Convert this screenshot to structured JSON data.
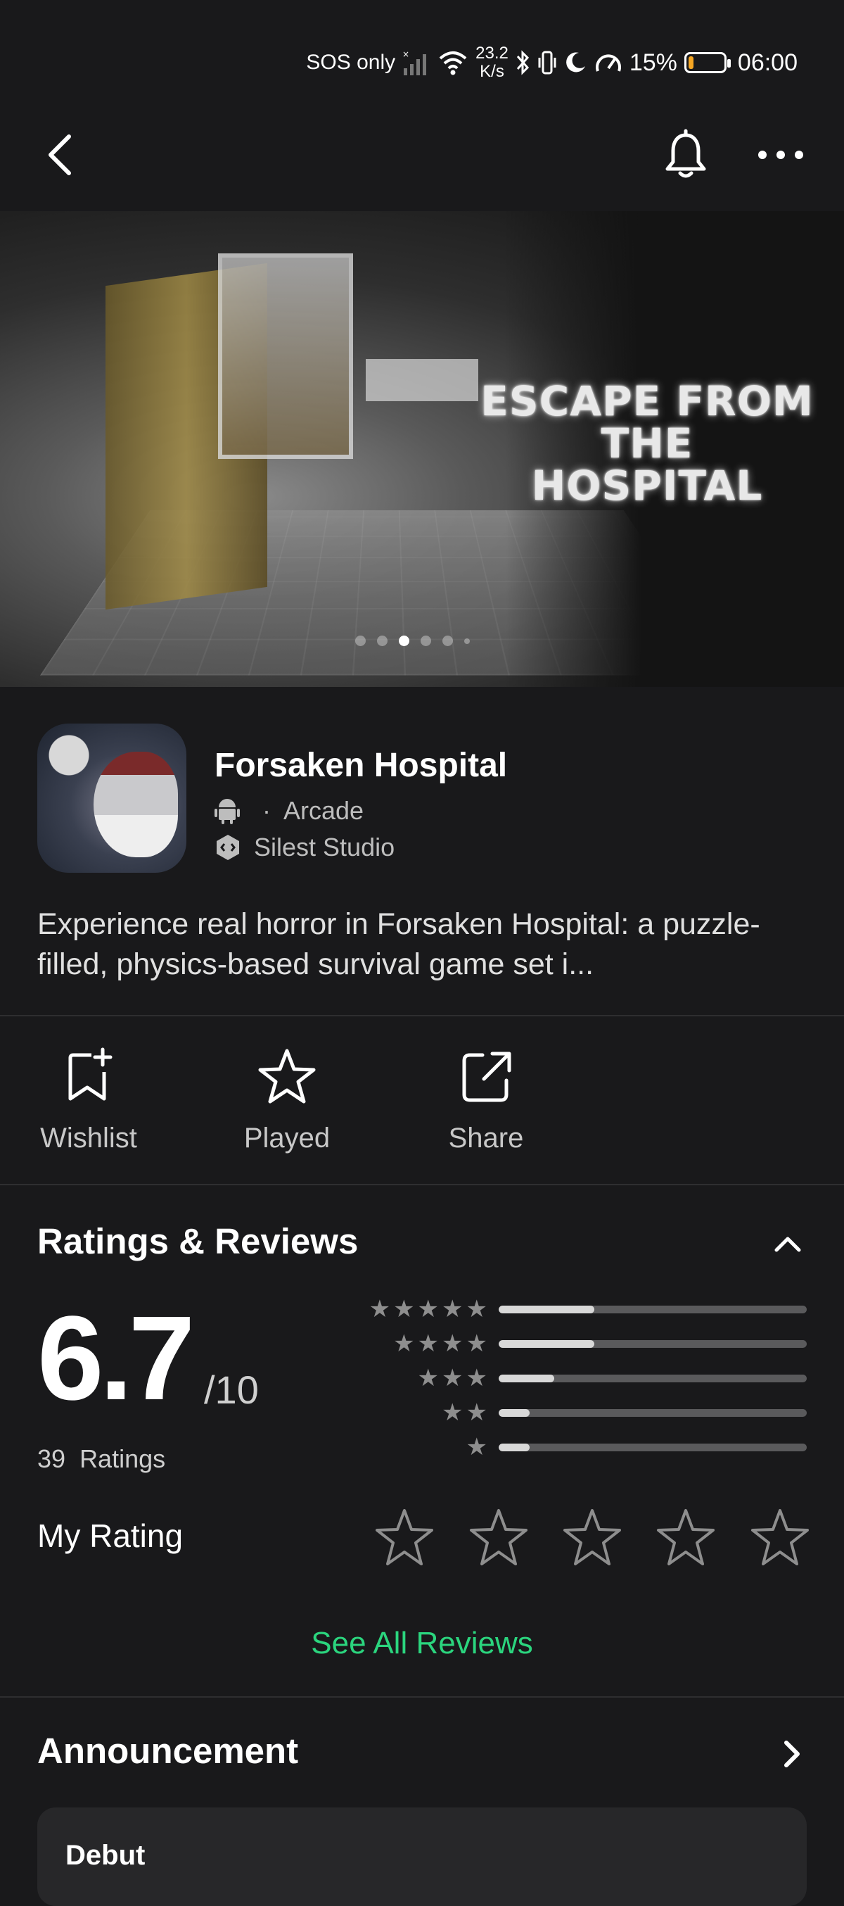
{
  "status_bar": {
    "carrier": "SOS only",
    "net_speed_value": "23.2",
    "net_speed_unit": "K/s",
    "battery_percent": "15%",
    "battery_level": 0.15,
    "time": "06:00",
    "battery_color": "#f5a623"
  },
  "nav": {
    "back_icon": "chevron-left-icon",
    "bell_icon": "bell-icon",
    "more_icon": "more-horizontal-icon"
  },
  "hero": {
    "title_lines": [
      "ESCAPE FROM",
      "THE",
      "HOSPITAL"
    ],
    "active_slide": 3,
    "slide_count": 6
  },
  "app": {
    "title": "Forsaken Hospital",
    "separator": "·",
    "genre": "Arcade",
    "developer": "Silest Studio",
    "platform_icon": "android-icon",
    "developer_icon": "studio-badge-icon",
    "description": "Experience real horror in Forsaken Hospital: a puzzle-filled, physics-based survival game set i..."
  },
  "actions": [
    {
      "label": "Wishlist",
      "icon": "bookmark-plus-icon"
    },
    {
      "label": "Played",
      "icon": "star-outline-icon"
    },
    {
      "label": "Share",
      "icon": "share-icon"
    }
  ],
  "ratings": {
    "section_title": "Ratings & Reviews",
    "score": "6.7",
    "score_scale": "/10",
    "count": "39",
    "count_label": "Ratings",
    "distribution": [
      {
        "stars": 5,
        "fraction": 0.31
      },
      {
        "stars": 4,
        "fraction": 0.31
      },
      {
        "stars": 3,
        "fraction": 0.18
      },
      {
        "stars": 2,
        "fraction": 0.1
      },
      {
        "stars": 1,
        "fraction": 0.1
      }
    ],
    "my_rating_label": "My Rating",
    "my_rating_value": 0,
    "see_all": "See All Reviews",
    "accent_color": "#2bd57e"
  },
  "announcement": {
    "title": "Announcement",
    "first_card_title": "Debut"
  }
}
